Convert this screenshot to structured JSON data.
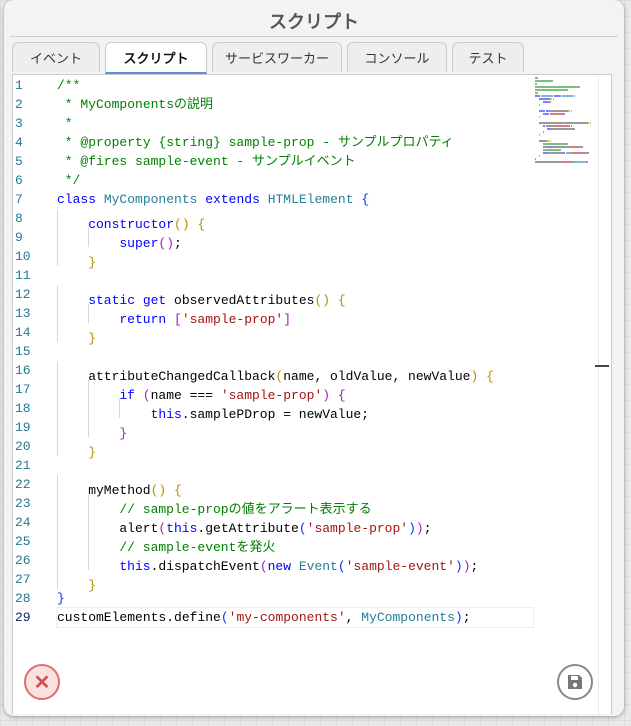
{
  "title": "スクリプト",
  "tabs": [
    {
      "label": "イベント"
    },
    {
      "label": "スクリプト",
      "active": true
    },
    {
      "label": "サービスワーカー"
    },
    {
      "label": "コンソール"
    },
    {
      "label": "テスト"
    }
  ],
  "colors": {
    "accent": "#5b8fd6",
    "close": "#d97070"
  },
  "editor": {
    "current_line": 29,
    "lines": [
      {
        "i": 0,
        "t": [
          [
            "c",
            "/**"
          ]
        ]
      },
      {
        "i": 0,
        "t": [
          [
            "c",
            " * MyComponentsの説明"
          ]
        ]
      },
      {
        "i": 0,
        "t": [
          [
            "c",
            " *"
          ]
        ]
      },
      {
        "i": 0,
        "t": [
          [
            "c",
            " * @property {string} sample-prop - サンプルプロパティ"
          ]
        ]
      },
      {
        "i": 0,
        "t": [
          [
            "c",
            " * @fires sample-event - サンプルイベント"
          ]
        ]
      },
      {
        "i": 0,
        "t": [
          [
            "c",
            " */"
          ]
        ]
      },
      {
        "i": 0,
        "t": [
          [
            "k",
            "class"
          ],
          [
            "p",
            " "
          ],
          [
            "t",
            "MyComponents"
          ],
          [
            "p",
            " "
          ],
          [
            "k",
            "extends"
          ],
          [
            "p",
            " "
          ],
          [
            "t",
            "HTMLElement"
          ],
          [
            "p",
            " "
          ],
          [
            "b0",
            "{"
          ]
        ]
      },
      {
        "i": 1,
        "t": [
          [
            "k",
            "constructor"
          ],
          [
            "b1",
            "()"
          ],
          [
            "p",
            " "
          ],
          [
            "b1",
            "{"
          ]
        ]
      },
      {
        "i": 2,
        "t": [
          [
            "k",
            "super"
          ],
          [
            "b2",
            "()"
          ],
          [
            "p",
            ";"
          ]
        ]
      },
      {
        "i": 1,
        "t": [
          [
            "b1",
            "}"
          ]
        ]
      },
      {
        "i": 0,
        "t": []
      },
      {
        "i": 1,
        "t": [
          [
            "k",
            "static"
          ],
          [
            "p",
            " "
          ],
          [
            "k",
            "get"
          ],
          [
            "p",
            " observedAttributes"
          ],
          [
            "b1",
            "()"
          ],
          [
            "p",
            " "
          ],
          [
            "b1",
            "{"
          ]
        ]
      },
      {
        "i": 2,
        "t": [
          [
            "k",
            "return"
          ],
          [
            "p",
            " "
          ],
          [
            "b2",
            "["
          ],
          [
            "s",
            "'sample-prop'"
          ],
          [
            "b2",
            "]"
          ]
        ]
      },
      {
        "i": 1,
        "t": [
          [
            "b1",
            "}"
          ]
        ]
      },
      {
        "i": 0,
        "t": []
      },
      {
        "i": 1,
        "t": [
          [
            "p",
            "attributeChangedCallback"
          ],
          [
            "b1",
            "("
          ],
          [
            "p",
            "name, oldValue, newValue"
          ],
          [
            "b1",
            ")"
          ],
          [
            "p",
            " "
          ],
          [
            "b1",
            "{"
          ]
        ]
      },
      {
        "i": 2,
        "t": [
          [
            "k",
            "if"
          ],
          [
            "p",
            " "
          ],
          [
            "b2",
            "("
          ],
          [
            "p",
            "name === "
          ],
          [
            "s",
            "'sample-prop'"
          ],
          [
            "b2",
            ")"
          ],
          [
            "p",
            " "
          ],
          [
            "b2",
            "{"
          ]
        ]
      },
      {
        "i": 3,
        "t": [
          [
            "k",
            "this"
          ],
          [
            "p",
            ".samplePDrop = newValue;"
          ]
        ]
      },
      {
        "i": 2,
        "t": [
          [
            "b2",
            "}"
          ]
        ]
      },
      {
        "i": 1,
        "t": [
          [
            "b1",
            "}"
          ]
        ]
      },
      {
        "i": 0,
        "t": []
      },
      {
        "i": 1,
        "t": [
          [
            "p",
            "myMethod"
          ],
          [
            "b1",
            "()"
          ],
          [
            "p",
            " "
          ],
          [
            "b1",
            "{"
          ]
        ]
      },
      {
        "i": 2,
        "t": [
          [
            "c",
            "// sample-propの値をアラート表示する"
          ]
        ]
      },
      {
        "i": 2,
        "t": [
          [
            "p",
            "alert"
          ],
          [
            "b2",
            "("
          ],
          [
            "k",
            "this"
          ],
          [
            "p",
            ".getAttribute"
          ],
          [
            "b3",
            "("
          ],
          [
            "s",
            "'sample-prop'"
          ],
          [
            "b3",
            ")"
          ],
          [
            "b2",
            ")"
          ],
          [
            "p",
            ";"
          ]
        ]
      },
      {
        "i": 2,
        "t": [
          [
            "c",
            "// sample-eventを発火"
          ]
        ]
      },
      {
        "i": 2,
        "t": [
          [
            "k",
            "this"
          ],
          [
            "p",
            ".dispatchEvent"
          ],
          [
            "b2",
            "("
          ],
          [
            "k",
            "new"
          ],
          [
            "p",
            " "
          ],
          [
            "t",
            "Event"
          ],
          [
            "b3",
            "("
          ],
          [
            "s",
            "'sample-event'"
          ],
          [
            "b3",
            ")"
          ],
          [
            "b2",
            ")"
          ],
          [
            "p",
            ";"
          ]
        ]
      },
      {
        "i": 1,
        "t": [
          [
            "b1",
            "}"
          ]
        ]
      },
      {
        "i": 0,
        "t": [
          [
            "b0",
            "}"
          ]
        ]
      },
      {
        "i": 0,
        "t": [
          [
            "p",
            "customElements.define"
          ],
          [
            "b0",
            "("
          ],
          [
            "s",
            "'my-components'"
          ],
          [
            "p",
            ", "
          ],
          [
            "t",
            "MyComponents"
          ],
          [
            "b0",
            ")"
          ],
          [
            "p",
            ";"
          ]
        ]
      }
    ]
  },
  "buttons": {
    "close_icon": "✕",
    "save_icon": "floppy-disk"
  }
}
